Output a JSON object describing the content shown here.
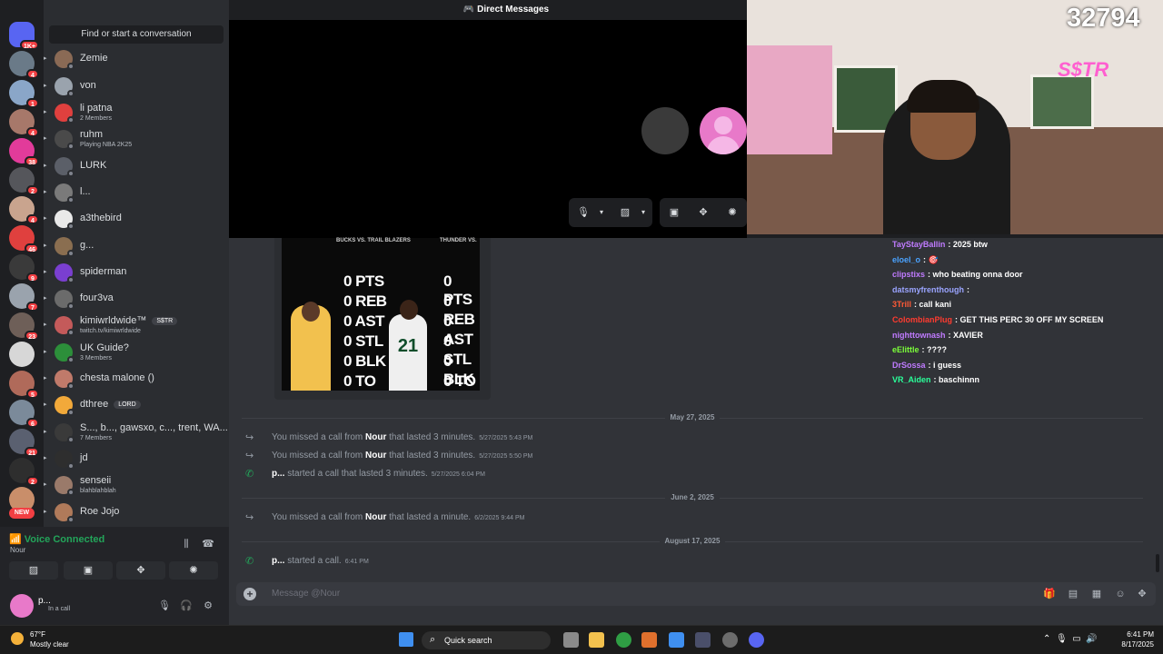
{
  "top_bar": {
    "title": "Direct Messages",
    "icon": "discord-dm-icon"
  },
  "search": {
    "label": "Find or start a conversation"
  },
  "rail": {
    "home_badge": "1K+",
    "badges": [
      "4",
      "1",
      "4",
      "38",
      "2",
      "4",
      "46",
      "9",
      "7",
      "23",
      "5",
      "6",
      "21",
      "2"
    ],
    "new_label": "NEW"
  },
  "dms": [
    {
      "name": "Zemie",
      "sub": ""
    },
    {
      "name": "von",
      "sub": ""
    },
    {
      "name": "li patna",
      "sub": "2 Members"
    },
    {
      "name": "ruhm",
      "sub": "Playing NBA 2K25"
    },
    {
      "name": "LURK",
      "sub": ""
    },
    {
      "name": "l...",
      "sub": ""
    },
    {
      "name": "a3thebird",
      "sub": ""
    },
    {
      "name": "g...",
      "sub": ""
    },
    {
      "name": "spiderman",
      "sub": ""
    },
    {
      "name": "four3va",
      "sub": ""
    },
    {
      "name": "kimiwrldwide™",
      "sub": "twitch.tv/kimiwrldwide",
      "tag": "S$TR"
    },
    {
      "name": "UK Guide?",
      "sub": "3 Members"
    },
    {
      "name": "chesta malone ()",
      "sub": ""
    },
    {
      "name": "dthree",
      "sub": "",
      "tag": "LORD"
    },
    {
      "name": "S..., b..., gawsxo, c..., trent, WA...",
      "sub": "7 Members"
    },
    {
      "name": "jd",
      "sub": ""
    },
    {
      "name": "senseii",
      "sub": "blahblahblah"
    },
    {
      "name": "Roe Jojo",
      "sub": ""
    }
  ],
  "voice": {
    "status": "Voice Connected",
    "channel": "Nour"
  },
  "user": {
    "name": "p...",
    "status": "In a call"
  },
  "game_card": {
    "left_header": "BUCKS VS. TRAIL BLAZERS",
    "right_header": "THUNDER VS.",
    "left_stats": [
      "0 PTS",
      "0 REB",
      "0 AST",
      "0 STL",
      "0 BLK",
      "0 TO"
    ],
    "right_stats": [
      "0 PTS",
      "0 REB",
      "0 AST",
      "0 STL",
      "0 BLK",
      "0 TO"
    ],
    "jersey": "21"
  },
  "messages": {
    "date1": "May 27, 2025",
    "date2": "June 2, 2025",
    "date3": "August 17, 2025",
    "c1": {
      "pre": "You missed a call from",
      "who": "Nour",
      "post": "that lasted 3 minutes.",
      "ts": "5/27/2025 5:43 PM"
    },
    "c2": {
      "pre": "You missed a call from",
      "who": "Nour",
      "post": "that lasted 3 minutes.",
      "ts": "5/27/2025 5:50 PM"
    },
    "c3": {
      "who": "p...",
      "post": "started a call that lasted 3 minutes.",
      "ts": "5/27/2025 6:04 PM"
    },
    "c4": {
      "pre": "You missed a call from",
      "who": "Nour",
      "post": "that lasted a minute.",
      "ts": "6/2/2025 9:44 PM"
    },
    "c5": {
      "who": "p...",
      "post": "started a call.",
      "ts": "6:41 PM"
    }
  },
  "composer": {
    "placeholder": "Message @Nour"
  },
  "chat": [
    {
      "user": "TayStayBallin",
      "msg": "2025 btw",
      "color": "#c07bff"
    },
    {
      "user": "eloel_o",
      "msg": "🎯",
      "color": "#4aa3ff"
    },
    {
      "user": "clipstixs",
      "msg": "who beating onna door",
      "color": "#c07bff"
    },
    {
      "user": "datsmyfrenthough",
      "msg": "",
      "color": "#9aa4ff"
    },
    {
      "user": "3Trill",
      "msg": "call kani",
      "color": "#ff5a36"
    },
    {
      "user": "ColombianPlug",
      "msg": "GET THIS PERC 30 OFF MY SCREEN",
      "color": "#ff3b30"
    },
    {
      "user": "nighttownash",
      "msg": "XAVIER",
      "color": "#c07bff"
    },
    {
      "user": "eElittle",
      "msg": "????",
      "color": "#7cff3a"
    },
    {
      "user": "DrSossa",
      "msg": "i guess",
      "color": "#c07bff"
    },
    {
      "user": "VR_Aiden",
      "msg": "baschinnn",
      "color": "#2aff9a"
    }
  ],
  "stream": {
    "viewers": "32794",
    "neon": "S$TR"
  },
  "taskbar": {
    "weather_temp": "67°F",
    "weather_desc": "Mostly clear",
    "search": "Quick search",
    "time": "6:41 PM",
    "date": "8/17/2025"
  },
  "colors": {
    "accent": "#5865f2",
    "online": "#23a55a",
    "danger": "#f23f43"
  }
}
